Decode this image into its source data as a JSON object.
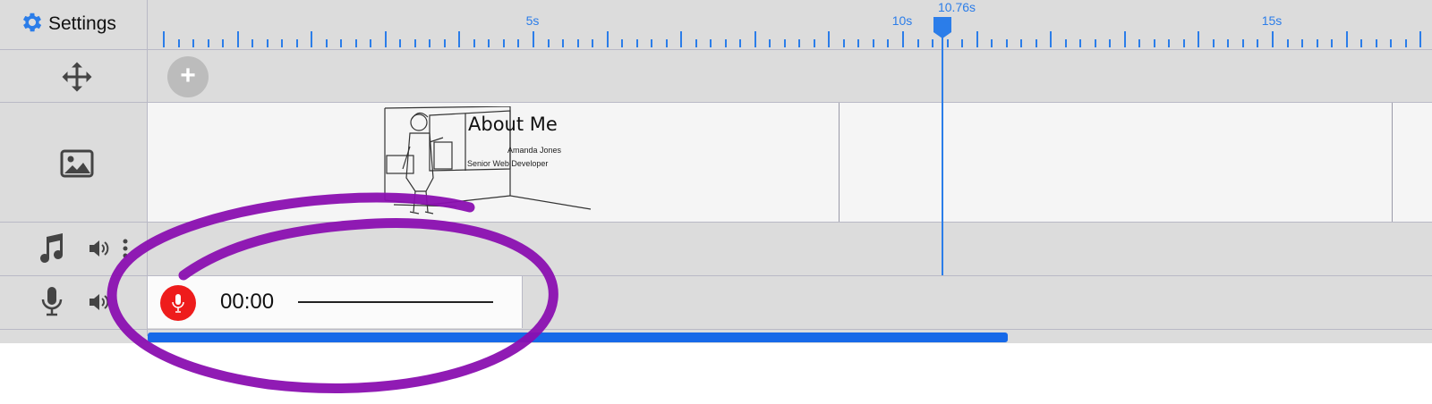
{
  "header": {
    "settings_label": "Settings",
    "settings_icon": "gear-icon"
  },
  "ruler": {
    "labels": [
      "5s",
      "10s",
      "15s"
    ],
    "accent_color": "#2b7de9"
  },
  "playhead": {
    "label": "10.76s"
  },
  "tracks": {
    "move": {
      "icon": "move-arrows-icon",
      "add_label": "+"
    },
    "image": {
      "icon": "image-icon"
    },
    "music": {
      "icon": "music-note-icon",
      "volume_icon": "speaker-icon",
      "menu_icon": "kebab-menu-icon"
    },
    "voice": {
      "icon": "microphone-icon",
      "volume_icon": "speaker-icon"
    }
  },
  "slide": {
    "title": "About Me",
    "name": "Amanda Jones",
    "role": "Senior Web Developer"
  },
  "recorder": {
    "time": "00:00",
    "record_color": "#ee1c1c"
  },
  "scrollbar_color": "#1769e8",
  "annotation_color": "#8a0fb0"
}
